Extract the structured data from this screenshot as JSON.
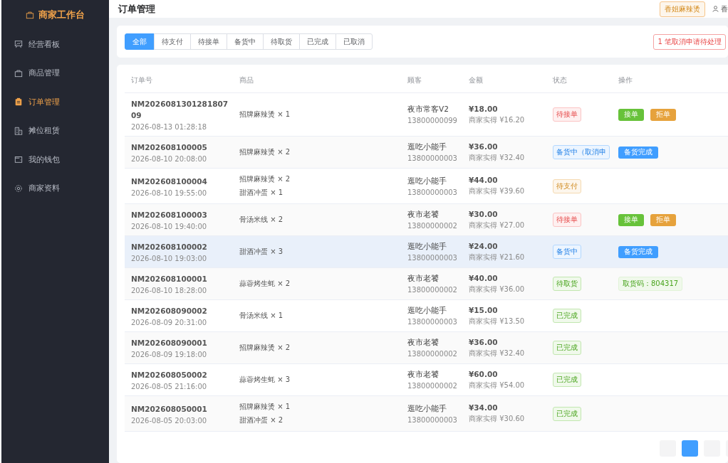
{
  "sidebar": {
    "brand": "商家工作台",
    "items": [
      {
        "label": "经营看板",
        "selected": false
      },
      {
        "label": "商品管理",
        "selected": false
      },
      {
        "label": "订单管理",
        "selected": true
      },
      {
        "label": "摊位租赁",
        "selected": false
      },
      {
        "label": "我的钱包",
        "selected": false
      },
      {
        "label": "商家资料",
        "selected": false
      }
    ]
  },
  "header": {
    "title": "订单管理",
    "shop_tag": "香姐麻辣烫",
    "user": "香"
  },
  "filter": {
    "tabs": [
      {
        "label": "全部",
        "selected": true
      },
      {
        "label": "待支付",
        "selected": false
      },
      {
        "label": "待接单",
        "selected": false
      },
      {
        "label": "备货中",
        "selected": false
      },
      {
        "label": "待取货",
        "selected": false
      },
      {
        "label": "已完成",
        "selected": false
      },
      {
        "label": "已取消",
        "selected": false
      }
    ],
    "notice": "1 笔取消申请待处理"
  },
  "table": {
    "columns": [
      "订单号",
      "商品",
      "顾客",
      "金额",
      "状态",
      "操作"
    ],
    "rows": [
      {
        "order_no": "NM202608130128180709",
        "time": "2026-08-13 01:28:18",
        "items": [
          "招牌麻辣烫 × 1"
        ],
        "customer": "夜市常客V2",
        "phone": "13800000099",
        "amount": "¥18.00",
        "net": "商家实得 ¥16.20",
        "status": {
          "kind": "pending",
          "label": "待接单"
        },
        "actions": [
          {
            "kind": "accept",
            "label": "接单"
          },
          {
            "kind": "reject",
            "label": "拒单"
          }
        ],
        "highlighted": false
      },
      {
        "order_no": "NM202608100005",
        "time": "2026-08-10 20:08:00",
        "items": [
          "招牌麻辣烫 × 2"
        ],
        "customer": "逛吃小能手",
        "phone": "13800000003",
        "amount": "¥36.00",
        "net": "商家实得 ¥32.40",
        "status": {
          "kind": "preparing",
          "label": "备货中（取消申"
        },
        "actions": [
          {
            "kind": "ready",
            "label": "备货完成"
          }
        ],
        "highlighted": false
      },
      {
        "order_no": "NM202608100004",
        "time": "2026-08-10 19:55:00",
        "items": [
          "招牌麻辣烫 × 2",
          "甜酒冲蛋 × 1"
        ],
        "customer": "逛吃小能手",
        "phone": "13800000003",
        "amount": "¥44.00",
        "net": "商家实得 ¥39.60",
        "status": {
          "kind": "unpaid",
          "label": "待支付"
        },
        "actions": [],
        "highlighted": false
      },
      {
        "order_no": "NM202608100003",
        "time": "2026-08-10 19:40:00",
        "items": [
          "骨汤米线 × 2"
        ],
        "customer": "夜市老饕",
        "phone": "13800000002",
        "amount": "¥30.00",
        "net": "商家实得 ¥27.00",
        "status": {
          "kind": "pending",
          "label": "待接单"
        },
        "actions": [
          {
            "kind": "accept",
            "label": "接单"
          },
          {
            "kind": "reject",
            "label": "拒单"
          }
        ],
        "highlighted": false
      },
      {
        "order_no": "NM202608100002",
        "time": "2026-08-10 19:03:00",
        "items": [
          "甜酒冲蛋 × 3"
        ],
        "customer": "逛吃小能手",
        "phone": "13800000003",
        "amount": "¥24.00",
        "net": "商家实得 ¥21.60",
        "status": {
          "kind": "preparing",
          "label": "备货中"
        },
        "actions": [
          {
            "kind": "ready",
            "label": "备货完成"
          }
        ],
        "highlighted": true
      },
      {
        "order_no": "NM202608100001",
        "time": "2026-08-10 18:28:00",
        "items": [
          "蒜蓉烤生蚝 × 2"
        ],
        "customer": "夜市老饕",
        "phone": "13800000002",
        "amount": "¥40.00",
        "net": "商家实得 ¥36.00",
        "status": {
          "kind": "pickup",
          "label": "待取货"
        },
        "actions": [
          {
            "kind": "code",
            "label": "取货码：804317"
          }
        ],
        "highlighted": false
      },
      {
        "order_no": "NM202608090002",
        "time": "2026-08-09 20:31:00",
        "items": [
          "骨汤米线 × 1"
        ],
        "customer": "逛吃小能手",
        "phone": "13800000003",
        "amount": "¥15.00",
        "net": "商家实得 ¥13.50",
        "status": {
          "kind": "done",
          "label": "已完成"
        },
        "actions": [],
        "highlighted": false
      },
      {
        "order_no": "NM202608090001",
        "time": "2026-08-09 19:18:00",
        "items": [
          "招牌麻辣烫 × 2"
        ],
        "customer": "夜市老饕",
        "phone": "13800000002",
        "amount": "¥36.00",
        "net": "商家实得 ¥32.40",
        "status": {
          "kind": "done",
          "label": "已完成"
        },
        "actions": [],
        "highlighted": false
      },
      {
        "order_no": "NM202608050002",
        "time": "2026-08-05 21:16:00",
        "items": [
          "蒜蓉烤生蚝 × 3"
        ],
        "customer": "夜市老饕",
        "phone": "13800000002",
        "amount": "¥60.00",
        "net": "商家实得 ¥54.00",
        "status": {
          "kind": "done",
          "label": "已完成"
        },
        "actions": [],
        "highlighted": false
      },
      {
        "order_no": "NM202608050001",
        "time": "2026-08-05 20:03:00",
        "items": [
          "招牌麻辣烫 × 1",
          "甜酒冲蛋 × 2"
        ],
        "customer": "逛吃小能手",
        "phone": "13800000003",
        "amount": "¥34.00",
        "net": "商家实得 ¥30.60",
        "status": {
          "kind": "done",
          "label": "已完成"
        },
        "actions": [],
        "highlighted": false
      }
    ]
  },
  "pagination": {
    "pages": [
      {
        "selected": false
      },
      {
        "selected": true
      },
      {
        "selected": false
      },
      {
        "selected": false
      }
    ]
  }
}
